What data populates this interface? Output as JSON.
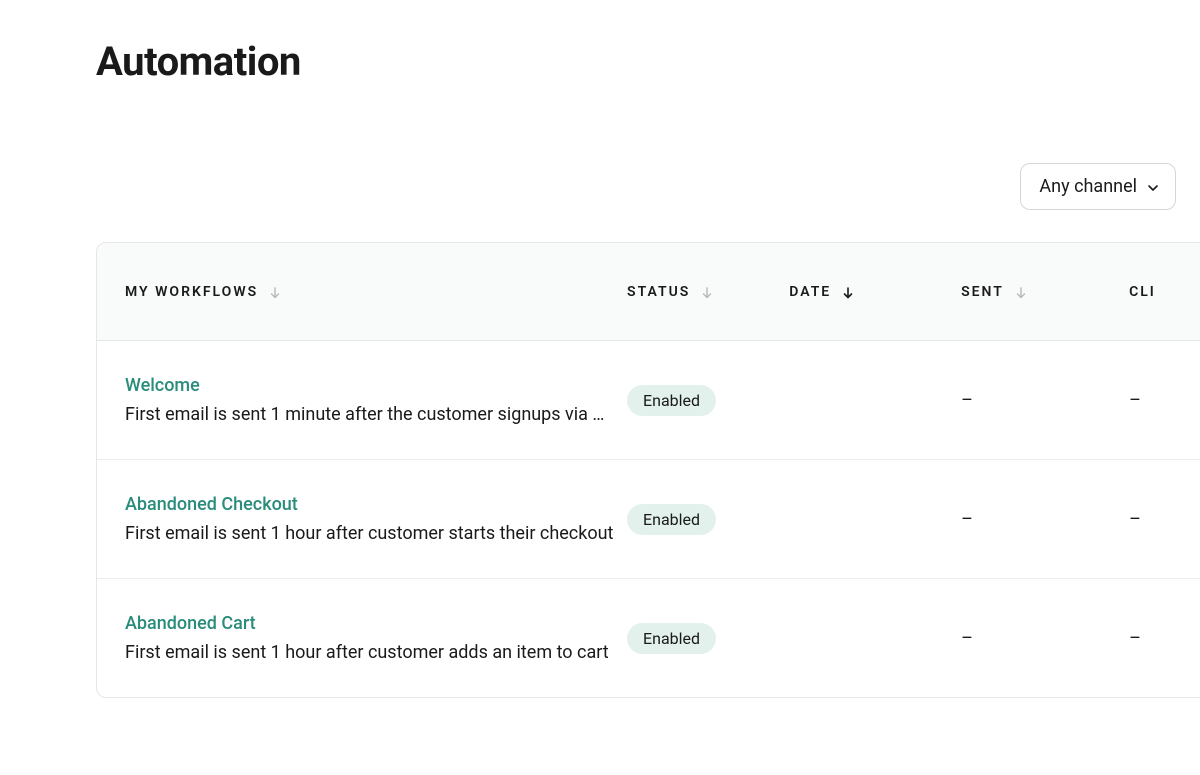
{
  "page": {
    "title": "Automation"
  },
  "filter": {
    "channel_label": "Any channel"
  },
  "table": {
    "headers": {
      "workflows": "My Workflows",
      "status": "Status",
      "date": "Date",
      "sent": "Sent",
      "click": "CLI"
    },
    "rows": [
      {
        "name": "Welcome",
        "description": "First email is sent 1 minute after the customer signups via …",
        "status": "Enabled",
        "sent": "–",
        "click": "–"
      },
      {
        "name": "Abandoned Checkout",
        "description": "First email is sent 1 hour after customer starts their checkout",
        "status": "Enabled",
        "sent": "–",
        "click": "–"
      },
      {
        "name": "Abandoned Cart",
        "description": "First email is sent 1 hour after customer adds an item to cart",
        "status": "Enabled",
        "sent": "–",
        "click": "–"
      }
    ]
  }
}
